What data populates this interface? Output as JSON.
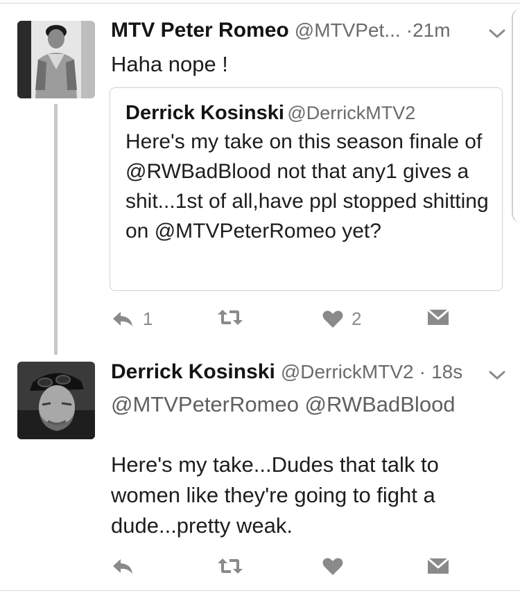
{
  "tweets": [
    {
      "display_name": "MTV Peter Romeo",
      "handle": "@MTVPet...",
      "separator": "·",
      "time": "21m",
      "text": "Haha nope !",
      "quoted": {
        "display_name": "Derrick Kosinski",
        "handle": "@DerrickMTV2",
        "text": "Here's my take on this season finale of @RWBadBlood not that any1 gives a shit...1st of all,have ppl stopped shitting on @MTVPeterRomeo yet?"
      },
      "actions": {
        "reply_count": "1",
        "like_count": "2"
      }
    },
    {
      "display_name": "Derrick Kosinski",
      "handle": "@DerrickMTV2",
      "separator": "·",
      "time": "18s",
      "mentions": "@MTVPeterRomeo @RWBadBlood",
      "text": "Here's my take...Dudes that talk to women like they're going to fight a dude...pretty weak.",
      "actions": {
        "reply_count": "",
        "like_count": ""
      }
    }
  ],
  "colors": {
    "text": "#1d1d1d",
    "muted": "#6b6b6b",
    "icon": "#8a8a8a",
    "border": "#d0d0d0"
  }
}
